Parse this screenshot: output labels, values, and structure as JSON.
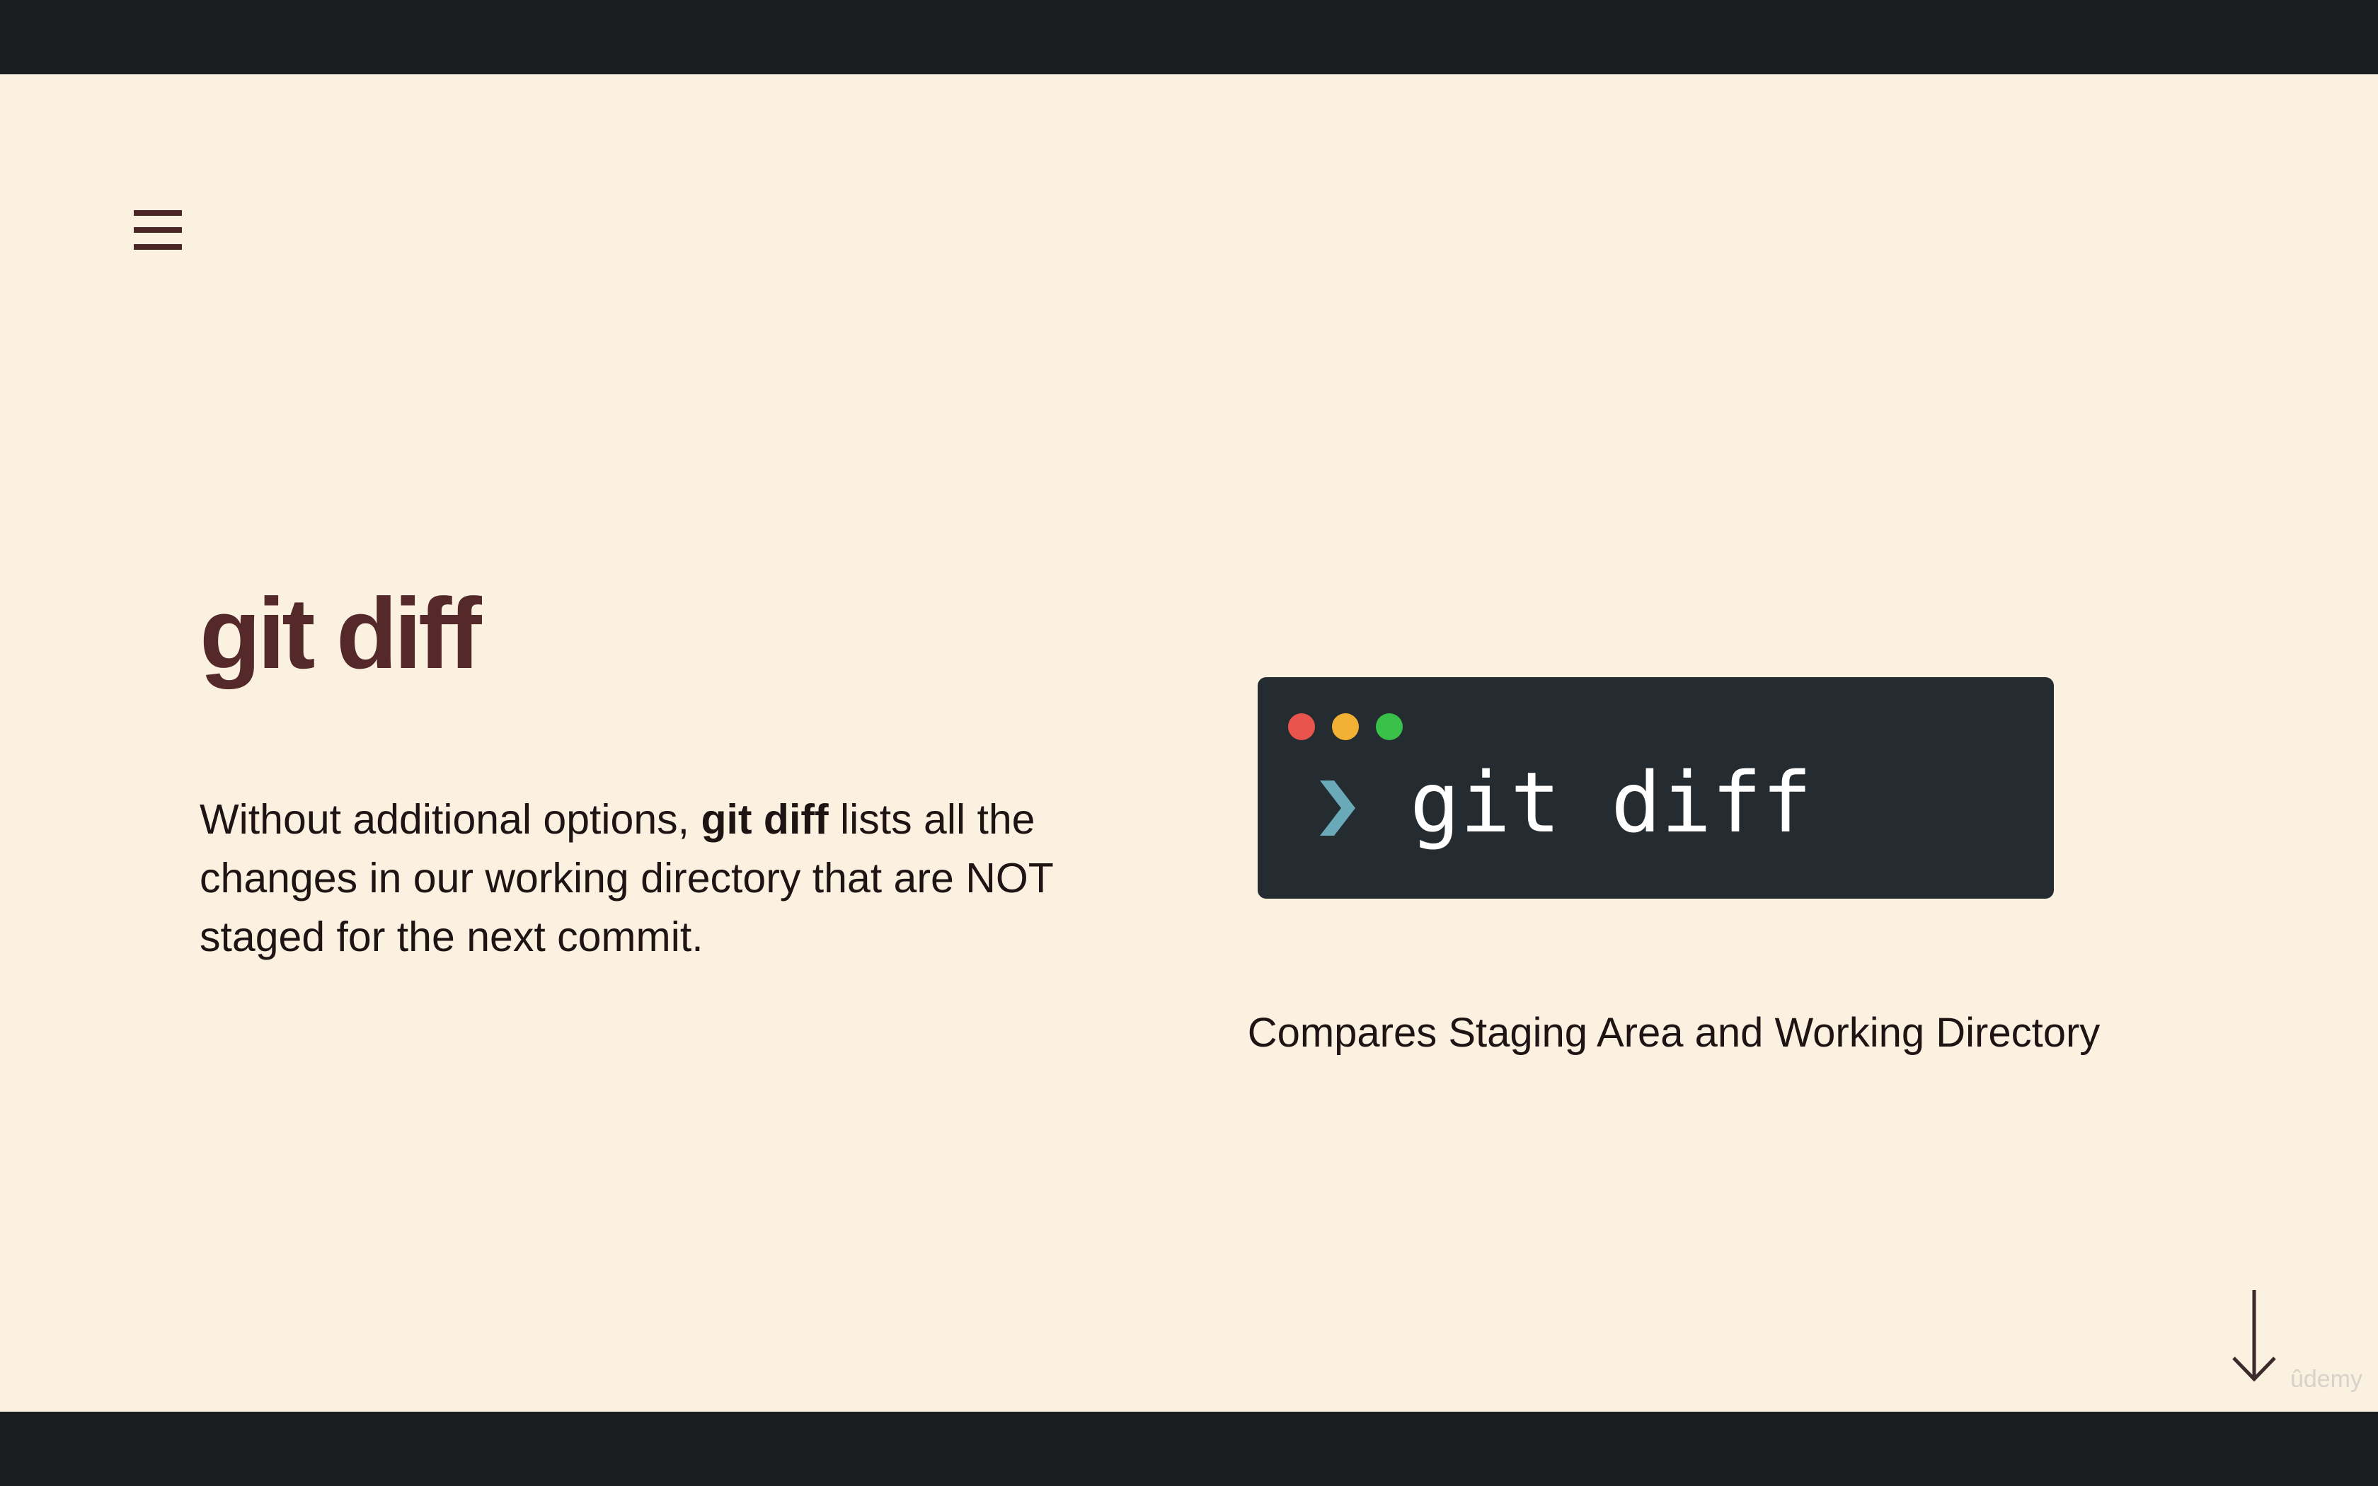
{
  "slide": {
    "title": "git diff",
    "description": {
      "before": "Without additional options, ",
      "emphasis": "git diff",
      "after": " lists all the changes in our working directory that are NOT staged for the next commit."
    },
    "caption": "Compares Staging Area and Working Directory"
  },
  "terminal": {
    "prompt_icon": "chevron-right-icon",
    "command": "git diff",
    "window_buttons": [
      "#e9544c",
      "#f2b134",
      "#39c14a"
    ]
  },
  "nav": {
    "menu_icon": "hamburger-menu-icon",
    "next_icon": "arrow-down-icon"
  },
  "colors": {
    "background": "#fbf1e1",
    "letterbox": "#1c1d1f",
    "title": "#55282a",
    "terminal": "#252c31",
    "prompt": "#6aaab8"
  },
  "brand": {
    "watermark": "ûdemy"
  }
}
